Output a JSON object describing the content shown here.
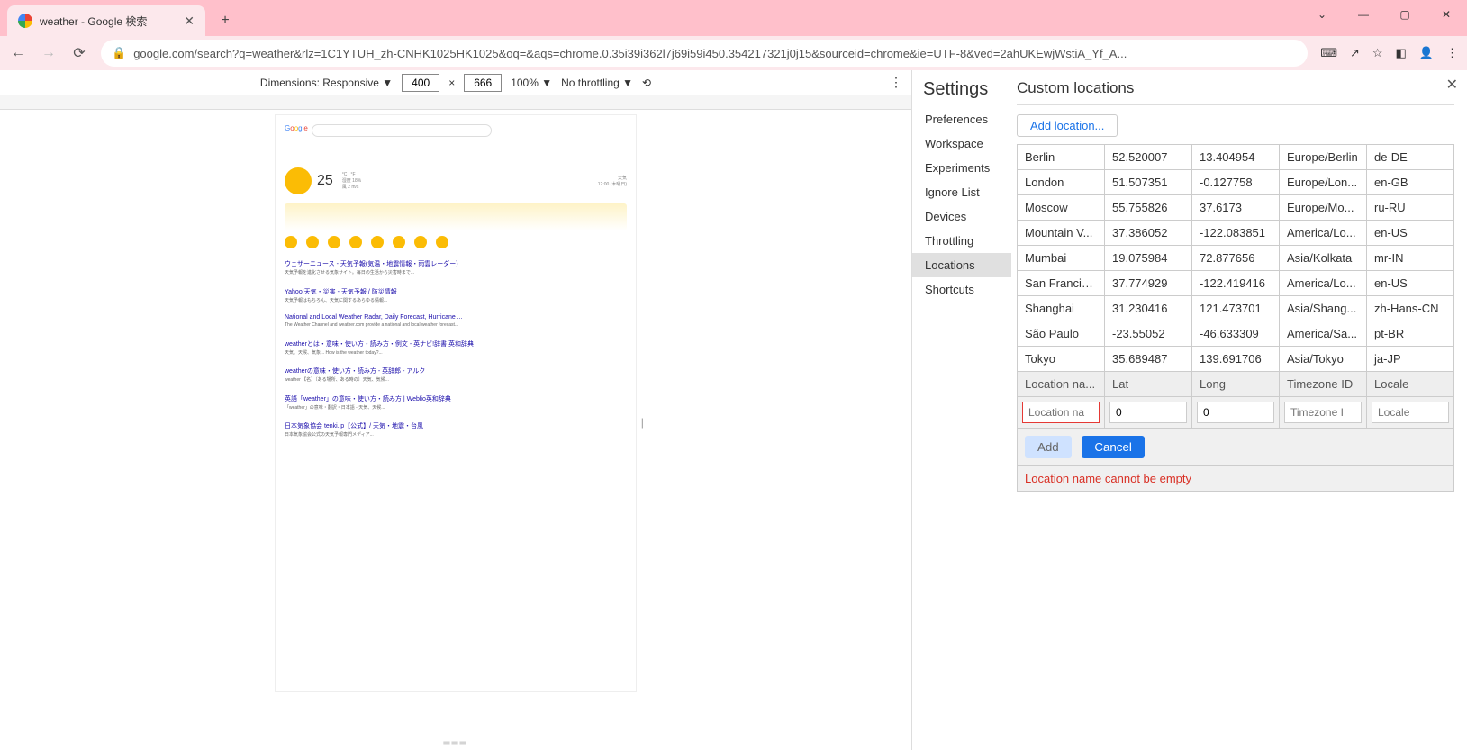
{
  "browser": {
    "tab_title": "weather - Google 検索",
    "url": "google.com/search?q=weather&rlz=1C1YTUH_zh-CNHK1025HK1025&oq=&aqs=chrome.0.35i39i362l7j69i59i450.354217321j0j15&sourceid=chrome&ie=UTF-8&ved=2ahUKEwjWstiA_Yf_A..."
  },
  "device_toolbar": {
    "dimensions_label": "Dimensions: Responsive ▼",
    "width": "400",
    "height": "666",
    "zoom": "100% ▼",
    "throttling": "No throttling ▼"
  },
  "page": {
    "query": "weather",
    "temp": "25"
  },
  "settings": {
    "title": "Settings",
    "items": [
      "Preferences",
      "Workspace",
      "Experiments",
      "Ignore List",
      "Devices",
      "Throttling",
      "Locations",
      "Shortcuts"
    ],
    "active_index": 6
  },
  "custom_locations": {
    "title": "Custom locations",
    "add_button": "Add location...",
    "headers": [
      "Location na...",
      "Lat",
      "Long",
      "Timezone ID",
      "Locale"
    ],
    "rows": [
      {
        "name": "Berlin",
        "lat": "52.520007",
        "long": "13.404954",
        "tz": "Europe/Berlin",
        "locale": "de-DE"
      },
      {
        "name": "London",
        "lat": "51.507351",
        "long": "-0.127758",
        "tz": "Europe/Lon...",
        "locale": "en-GB"
      },
      {
        "name": "Moscow",
        "lat": "55.755826",
        "long": "37.6173",
        "tz": "Europe/Mo...",
        "locale": "ru-RU"
      },
      {
        "name": "Mountain V...",
        "lat": "37.386052",
        "long": "-122.083851",
        "tz": "America/Lo...",
        "locale": "en-US"
      },
      {
        "name": "Mumbai",
        "lat": "19.075984",
        "long": "72.877656",
        "tz": "Asia/Kolkata",
        "locale": "mr-IN"
      },
      {
        "name": "San Francisco",
        "lat": "37.774929",
        "long": "-122.419416",
        "tz": "America/Lo...",
        "locale": "en-US"
      },
      {
        "name": "Shanghai",
        "lat": "31.230416",
        "long": "121.473701",
        "tz": "Asia/Shang...",
        "locale": "zh-Hans-CN"
      },
      {
        "name": "São Paulo",
        "lat": "-23.55052",
        "long": "-46.633309",
        "tz": "America/Sa...",
        "locale": "pt-BR"
      },
      {
        "name": "Tokyo",
        "lat": "35.689487",
        "long": "139.691706",
        "tz": "Asia/Tokyo",
        "locale": "ja-JP"
      }
    ],
    "new_row": {
      "name_placeholder": "Location na",
      "lat": "0",
      "long": "0",
      "tz_placeholder": "Timezone I",
      "locale_placeholder": "Locale"
    },
    "add_label": "Add",
    "cancel_label": "Cancel",
    "error": "Location name cannot be empty"
  }
}
